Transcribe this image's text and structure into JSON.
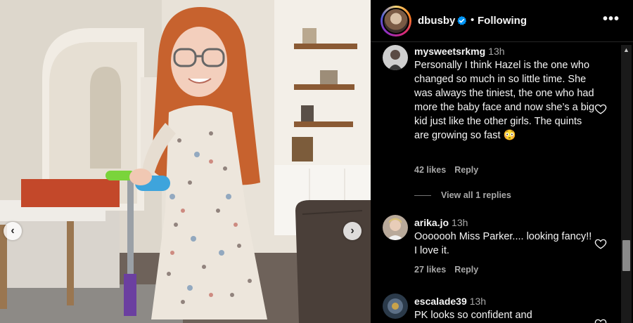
{
  "post": {
    "username": "dbusby",
    "verified": true,
    "separator": "•",
    "follow_status": "Following",
    "more_icon": "more-horizontal-icon"
  },
  "carousel": {
    "prev_icon": "‹",
    "next_icon": "›"
  },
  "comments": [
    {
      "username": "mysweetsrkmg",
      "time": "13h",
      "text": "Personally I think Hazel is the one who changed so much in so little time. She was always the tiniest, the one who had more the baby face and now she’s a big kid just like the other girls. The quints are growing so fast 😳",
      "likes": "42 likes",
      "reply": "Reply",
      "view_replies": "View all 1 replies"
    },
    {
      "username": "arika.jo",
      "time": "13h",
      "text": "Ooooooh Miss Parker.... looking fancy!! I love it.",
      "likes": "27 likes",
      "reply": "Reply"
    },
    {
      "username": "escalade39",
      "time": "13h",
      "text": "PK looks so confident and"
    }
  ],
  "colors": {
    "background": "#000000",
    "text_primary": "#f5f5f5",
    "text_secondary": "#a8a8a8",
    "verified_blue": "#0095f6"
  }
}
